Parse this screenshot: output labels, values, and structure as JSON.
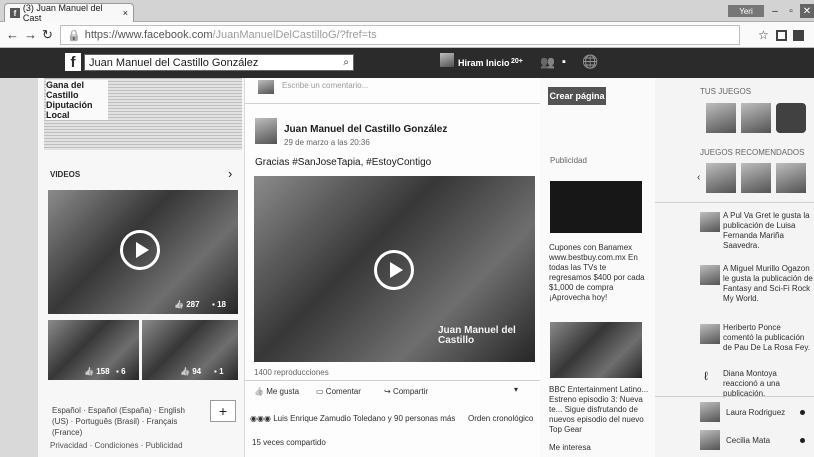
{
  "browser": {
    "tab_title": "(3) Juan Manuel del Cast",
    "tab_close": "×",
    "user_badge": "Yeri",
    "url_host": "https://www.facebook.com",
    "url_path": "/JuanManuelDelCastilloG/?fref=ts"
  },
  "fb": {
    "logo": "f",
    "search_value": "Juan Manuel del Castillo González",
    "nav_user": "Hiram",
    "nav_home": "Inicio",
    "nav_home_count": "20+"
  },
  "left": {
    "headline": "Gana del Castillo Diputación Local",
    "videos_label": "VIDEOS",
    "featured_likes": "287",
    "featured_comments": "18",
    "thumb1_likes": "158",
    "thumb1_comments": "6",
    "thumb2_likes": "94",
    "thumb2_comments": "1",
    "languages": "Español · Español (España) · English (US) · Português (Brasil) · Français (France)",
    "add_lang": "+",
    "footer": "Privacidad · Condiciones · Publicidad"
  },
  "post": {
    "composer_placeholder": "Escribe un comentario...",
    "author": "Juan Manuel del Castillo González",
    "time": "29 de marzo a las 20:36",
    "text": "Gracias #SanJoseTapia, #EstoyContigo",
    "watermark": "Juan Manuel del Castillo",
    "views": "1400 reproducciones",
    "like": "Me gusta",
    "comment": "Comentar",
    "share": "Compartir",
    "likers": "Luis Enrique Zamudio Toledano y 90 personas más",
    "order": "Orden cronológico",
    "shares": "15 veces compartido"
  },
  "ads": {
    "create_page": "Crear página",
    "label": "Publicidad",
    "ad1_text": "Cupones con Banamex www.bestbuy.com.mx En todas las TVs te regresamos $400 por cada $1,000 de compra ¡Aprovecha hoy!",
    "ad2_text": "BBC Entertainment Latino... Estreno episodio 3: Nueva te... Sigue disfrutando de nuevos episodio del nuevo Top Gear",
    "ad2_footer": "Me interesa"
  },
  "ticker": {
    "games_label": "TUS JUEGOS",
    "rec_games_label": "JUEGOS RECOMENDADOS",
    "items": [
      "A Pul Va Gret le gusta la publicación de Luisa Fernanda Mariña Saavedra.",
      "A Miguel Murillo Ogazon le gusta la publicación de Fantasy and Sci-Fi Rock My World.",
      "Heriberto Ponce comentó la publicación de Pau De La Rosa Fey.",
      "Diana Montoya reaccionó a una publicación."
    ],
    "chat": [
      "Laura Rodriguez",
      "Cecilia Mata"
    ]
  }
}
